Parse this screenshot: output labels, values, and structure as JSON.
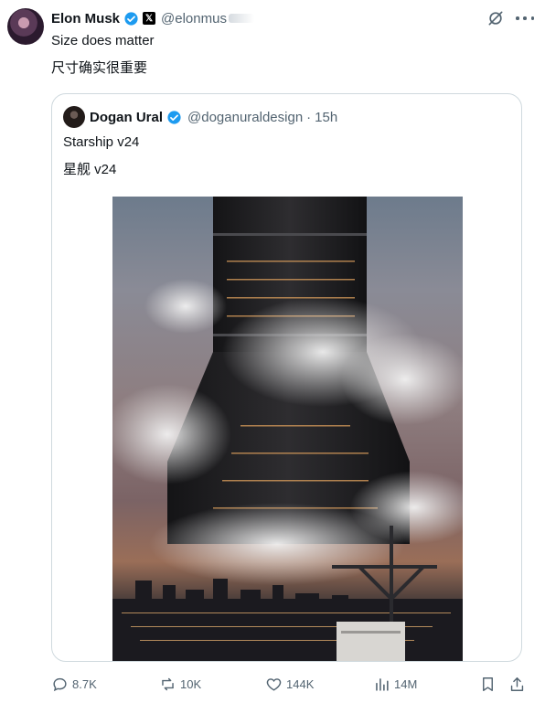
{
  "tweet": {
    "author_name": "Elon Musk",
    "handle": "@elonmus",
    "line1": "Size does matter",
    "line2": "尺寸确实很重要"
  },
  "quoted": {
    "author_name": "Dogan Ural",
    "handle": "@doganuraldesign",
    "separator": "·",
    "time": "15h",
    "line1": "Starship v24",
    "line2": "星舰 v24"
  },
  "stats": {
    "replies": "8.7K",
    "reposts": "10K",
    "likes": "144K",
    "views": "14M"
  },
  "colors": {
    "verified": "#1d9bf0",
    "secondary_text": "#536471",
    "border": "#cfd9de"
  },
  "icons": {
    "verified": "verified-badge-icon",
    "affiliate": "x-logo-icon",
    "grok": "grok-icon",
    "more": "more-icon",
    "reply": "reply-icon",
    "repost": "repost-icon",
    "like": "heart-icon",
    "views": "views-chart-icon",
    "bookmark": "bookmark-icon",
    "share": "share-icon"
  }
}
